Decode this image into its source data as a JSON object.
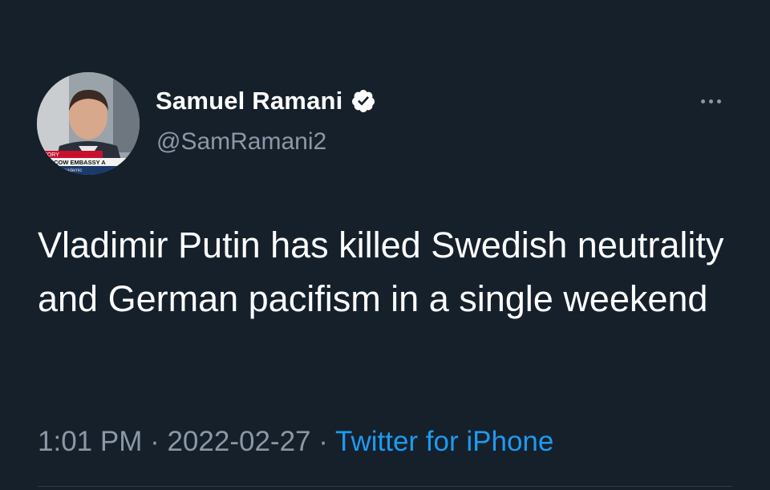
{
  "tweet": {
    "author": {
      "display_name": "Samuel Ramani",
      "handle": "@SamRamani2",
      "verified_icon": "verified-badge-icon",
      "avatar_banner": {
        "story_label": "STORY",
        "headline": "MOSCOW EMBASSY A",
        "caption": "Academic"
      }
    },
    "text": "Vladimir Putin has killed Swedish neutrality and German pacifism in a single weekend",
    "meta": {
      "time": "1:01 PM",
      "separator": " · ",
      "date": "2022-02-27",
      "source": "Twitter for iPhone"
    },
    "more_icon": "more-options-icon"
  },
  "colors": {
    "background": "#15202b",
    "text_primary": "#ffffff",
    "text_secondary": "#8b98a5",
    "accent": "#1d9bf0"
  }
}
